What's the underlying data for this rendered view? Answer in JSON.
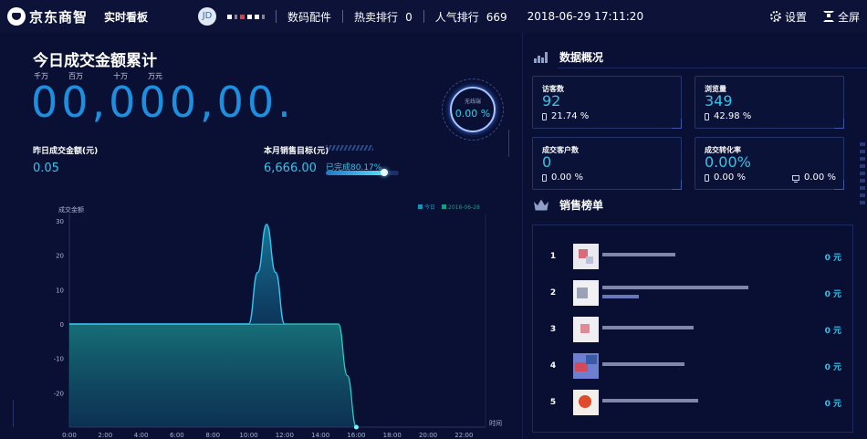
{
  "topbar": {
    "logo_text": "京东商智",
    "board_name": "实时看板",
    "store_avatar": "JD",
    "category": "数码配件",
    "hot_label": "热卖排行",
    "hot_value": "0",
    "popularity_label": "人气排行",
    "popularity_value": "669",
    "datetime": "2018-06-29 17:11:20",
    "settings_label": "设置",
    "fullscreen_label": "全屏"
  },
  "today": {
    "title": "今日成交金额累计",
    "units": [
      "千万",
      "百万",
      "十万",
      "万元"
    ],
    "digits": "00,000,00.",
    "ring_label": "无线端",
    "ring_value": "0.00 %",
    "yesterday_label": "昨日成交金额(元)",
    "yesterday_value": "0.05",
    "goal_label": "本月销售目标(元)",
    "goal_value": "6,666.00",
    "done_label": "已完成80.17%",
    "done_fraction": 0.8017
  },
  "chart_data": {
    "type": "area",
    "ylabel": "成交金额",
    "xlabel": "时间",
    "ylim": [
      -30,
      30
    ],
    "yticks": [
      30,
      20,
      10,
      0,
      -10,
      -20
    ],
    "x_ticks": [
      "0:00",
      "2:00",
      "4:00",
      "6:00",
      "8:00",
      "10:00",
      "12:00",
      "14:00",
      "16:00",
      "18:00",
      "20:00",
      "22:00"
    ],
    "legend_position": "top-right",
    "series": [
      {
        "name": "今日",
        "color": "#1f8fb5",
        "x": [
          0,
          10,
          10.5,
          11,
          11.5,
          12
        ],
        "y": [
          0,
          0,
          15,
          29,
          15,
          0
        ]
      },
      {
        "name": "2018-06-28",
        "color": "#1a9a86",
        "x": [
          0,
          15,
          15.5,
          16
        ],
        "y": [
          0,
          0,
          -15,
          -30
        ]
      }
    ]
  },
  "overview": {
    "title": "数据概况",
    "cards": [
      {
        "title": "访客数",
        "value": "92",
        "sub1": "21.74 %",
        "sub2": ""
      },
      {
        "title": "浏览量",
        "value": "349",
        "sub1": "42.98 %",
        "sub2": ""
      },
      {
        "title": "成交客户数",
        "value": "0",
        "sub1": "0.00 %",
        "sub2": ""
      },
      {
        "title": "成交转化率",
        "value": "0.00%",
        "sub1": "0.00 %",
        "sub2": "0.00 %"
      }
    ]
  },
  "ranking": {
    "title": "销售榜单",
    "items": [
      {
        "rank": "1",
        "amount": "0 元"
      },
      {
        "rank": "2",
        "amount": "0 元"
      },
      {
        "rank": "3",
        "amount": "0 元"
      },
      {
        "rank": "4",
        "amount": "0 元"
      },
      {
        "rank": "5",
        "amount": "0 元"
      }
    ]
  }
}
